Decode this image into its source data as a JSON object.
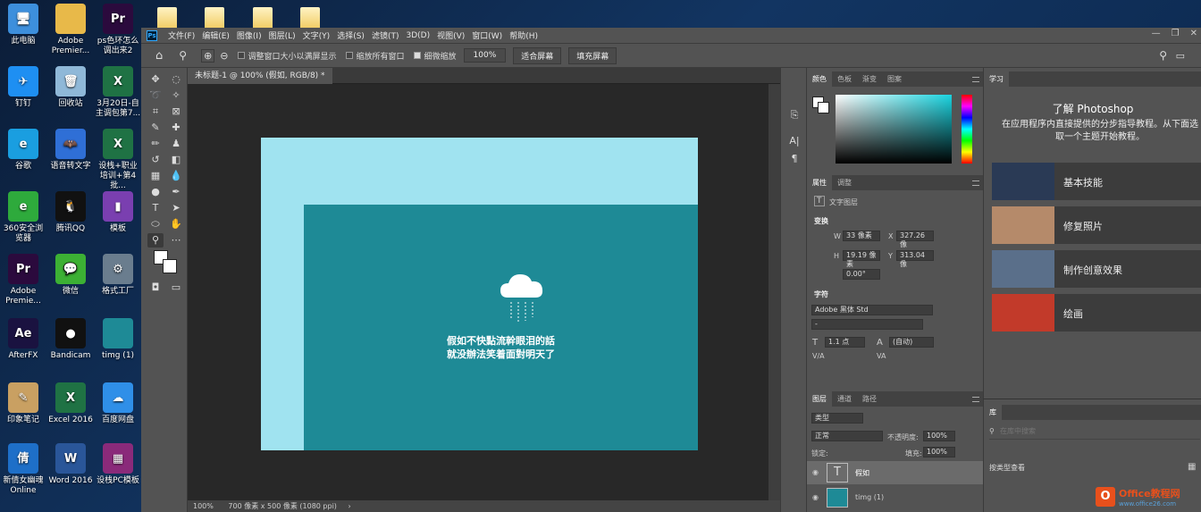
{
  "desktop": {
    "icons": [
      {
        "label": "此电脑",
        "icon": "computer-icon",
        "color": "#3d8fdc",
        "glyph": "🖥"
      },
      {
        "label": "Adobe Premier...",
        "icon": "folder-icon",
        "color": "#e8b949",
        "glyph": ""
      },
      {
        "label": "ps色环怎么调出来2",
        "icon": "premiere-pro-icon",
        "color": "#2b0a3d",
        "glyph": "Pr"
      },
      {
        "label": "钉钉",
        "icon": "dingtalk-icon",
        "color": "#1e8ff2",
        "glyph": "✈"
      },
      {
        "label": "回收站",
        "icon": "recycle-bin-icon",
        "color": "#8fb8d8",
        "glyph": "🗑"
      },
      {
        "label": "3月20日-自主调包第7...",
        "icon": "excel-file-icon",
        "color": "#1f7244",
        "glyph": "X"
      },
      {
        "label": "谷歌",
        "icon": "browser-icon",
        "color": "#1a9ee0",
        "glyph": "e"
      },
      {
        "label": "语音转文字",
        "icon": "speech-to-text-icon",
        "color": "#2f6fd6",
        "glyph": "🦇"
      },
      {
        "label": "设栈+职业培训+第4批...",
        "icon": "excel-file-icon",
        "color": "#1f7244",
        "glyph": "X"
      },
      {
        "label": "360安全浏览器",
        "icon": "360-browser-icon",
        "color": "#2eaa3c",
        "glyph": "e"
      },
      {
        "label": "腾讯QQ",
        "icon": "qq-icon",
        "color": "#111111",
        "glyph": "🐧"
      },
      {
        "label": "模板",
        "icon": "archive-icon",
        "color": "#7a3fb0",
        "glyph": "▮"
      },
      {
        "label": "Adobe Premie...",
        "icon": "premiere-pro-icon",
        "color": "#2b0a3d",
        "glyph": "Pr"
      },
      {
        "label": "微信",
        "icon": "wechat-icon",
        "color": "#3cb034",
        "glyph": "💬"
      },
      {
        "label": "格式工厂",
        "icon": "format-factory-icon",
        "color": "#6a7d8e",
        "glyph": "⚙"
      },
      {
        "label": "AfterFX",
        "icon": "after-effects-icon",
        "color": "#1a1240",
        "glyph": "Ae"
      },
      {
        "label": "Bandicam",
        "icon": "bandicam-icon",
        "color": "#111111",
        "glyph": "●"
      },
      {
        "label": "timg (1)",
        "icon": "image-file-icon",
        "color": "#1e8a96",
        "glyph": ""
      },
      {
        "label": "印象笔记",
        "icon": "evernote-icon",
        "color": "#c9a062",
        "glyph": "✎"
      },
      {
        "label": "Excel 2016",
        "icon": "excel-icon",
        "color": "#1f7244",
        "glyph": "X"
      },
      {
        "label": "百度网盘",
        "icon": "baidu-netdisk-icon",
        "color": "#2f8fe8",
        "glyph": "☁"
      },
      {
        "label": "新倩女幽魂Online",
        "icon": "game-icon",
        "color": "#1e6fc8",
        "glyph": "倩"
      },
      {
        "label": "Word 2016",
        "icon": "word-icon",
        "color": "#2a5699",
        "glyph": "W"
      },
      {
        "label": "设栈PC模板",
        "icon": "winrar-icon",
        "color": "#8a2a7a",
        "glyph": "▦"
      }
    ]
  },
  "ps": {
    "menus": [
      "文件(F)",
      "编辑(E)",
      "图像(I)",
      "图层(L)",
      "文字(Y)",
      "选择(S)",
      "滤镜(T)",
      "3D(D)",
      "视图(V)",
      "窗口(W)",
      "帮助(H)"
    ],
    "options": {
      "resize_windows": "调整窗口大小以满屏显示",
      "zoom_all": "缩放所有窗口",
      "scrubby_zoom": "细微缩放",
      "zoom_value": "100%",
      "fit_screen": "适合屏幕",
      "fill_screen": "填充屏幕"
    },
    "doc_tab": "未标题-1 @ 100% (假如, RGB/8) *",
    "canvas_text": {
      "line1": "假如不快點流幹眼泪的話",
      "line2": "就没辦法笑着面對明天了"
    },
    "status": {
      "zoom": "100%",
      "info": "700 像素 x 500 像素 (1080 ppi)"
    },
    "color_panel": {
      "tabs": [
        "颜色",
        "色板",
        "渐变",
        "图案"
      ]
    },
    "props_panel": {
      "tabs": [
        "属性",
        "调整"
      ],
      "type_label": "文字图层",
      "transform": "变换",
      "w_label": "W",
      "w": "33 像素",
      "x_label": "X",
      "x": "327.26 像",
      "h_label": "H",
      "h": "19.19 像素",
      "y_label": "Y",
      "y": "313.04 像",
      "angle": "0.00°",
      "char": "字符",
      "font": "Adobe 黑体 Std",
      "font_style": "-",
      "size": "1.1 点",
      "leading": "(自动)",
      "va_label": "V/A",
      "va_label2": "VA"
    },
    "layers_panel": {
      "tabs": [
        "图层",
        "通道",
        "路径"
      ],
      "filter": "类型",
      "blend": "正常",
      "opacity_label": "不透明度:",
      "opacity": "100%",
      "lock_label": "锁定:",
      "fill_label": "填充:",
      "fill": "100%",
      "layers": [
        {
          "name": "假如"
        },
        {
          "name": "timg (1)"
        }
      ]
    },
    "learn_panel": {
      "tab": "学习",
      "title": "了解 Photoshop",
      "desc": "在应用程序内直接提供的分步指导教程。从下面选取一个主题开始教程。",
      "cards": [
        {
          "label": "基本技能",
          "color": "#2a3a55"
        },
        {
          "label": "修复照片",
          "color": "#b58a6a"
        },
        {
          "label": "制作创意效果",
          "color": "#5a6f8a"
        },
        {
          "label": "绘画",
          "color": "#c23a2a"
        }
      ]
    },
    "library_panel": {
      "tab": "库",
      "search_placeholder": "在库中搜索",
      "view": "按类型查看"
    }
  },
  "watermark": {
    "brand": "Office教程网",
    "url": "www.office26.com"
  }
}
